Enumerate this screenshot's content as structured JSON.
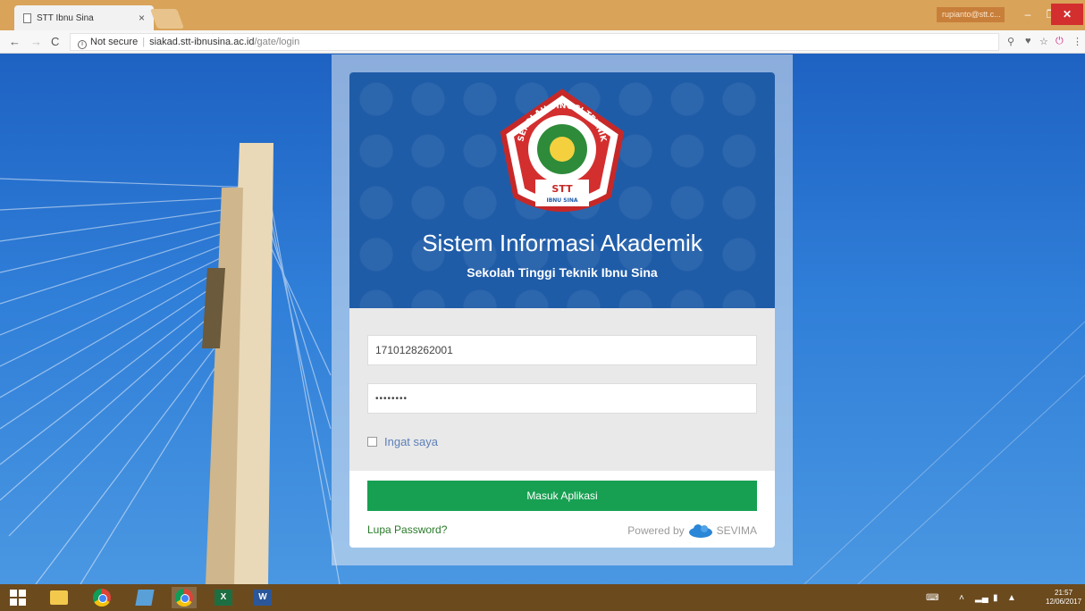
{
  "browser": {
    "tab_title": "STT Ibnu Sina",
    "tab_close": "×",
    "profile": "rupianto@stt.c...",
    "address": {
      "security": "Not secure",
      "domain": "siakad.stt-ibnusina.ac.id",
      "path": "/gate/login"
    }
  },
  "login": {
    "logo": {
      "arc_text": "SEKOLAH TINGGI TEKNIK",
      "acronym": "STT",
      "name": "IBNU SINA"
    },
    "title": "Sistem Informasi Akademik",
    "subtitle": "Sekolah Tinggi Teknik Ibnu Sina",
    "username_value": "1710128262001",
    "password_value": "••••••••",
    "remember_label": "Ingat saya",
    "submit_label": "Masuk Aplikasi",
    "forgot_label": "Lupa Password?",
    "powered_by": "Powered by",
    "vendor": "SEVIMA"
  },
  "taskbar": {
    "clock_time": "21:57",
    "clock_date": "12/06/2017"
  },
  "colors": {
    "header_blue": "#1f5ca8",
    "button_green": "#17a052",
    "link_green": "#2a7a2a",
    "titlebar": "#d9a35a",
    "taskbar": "#6b4a1e"
  }
}
